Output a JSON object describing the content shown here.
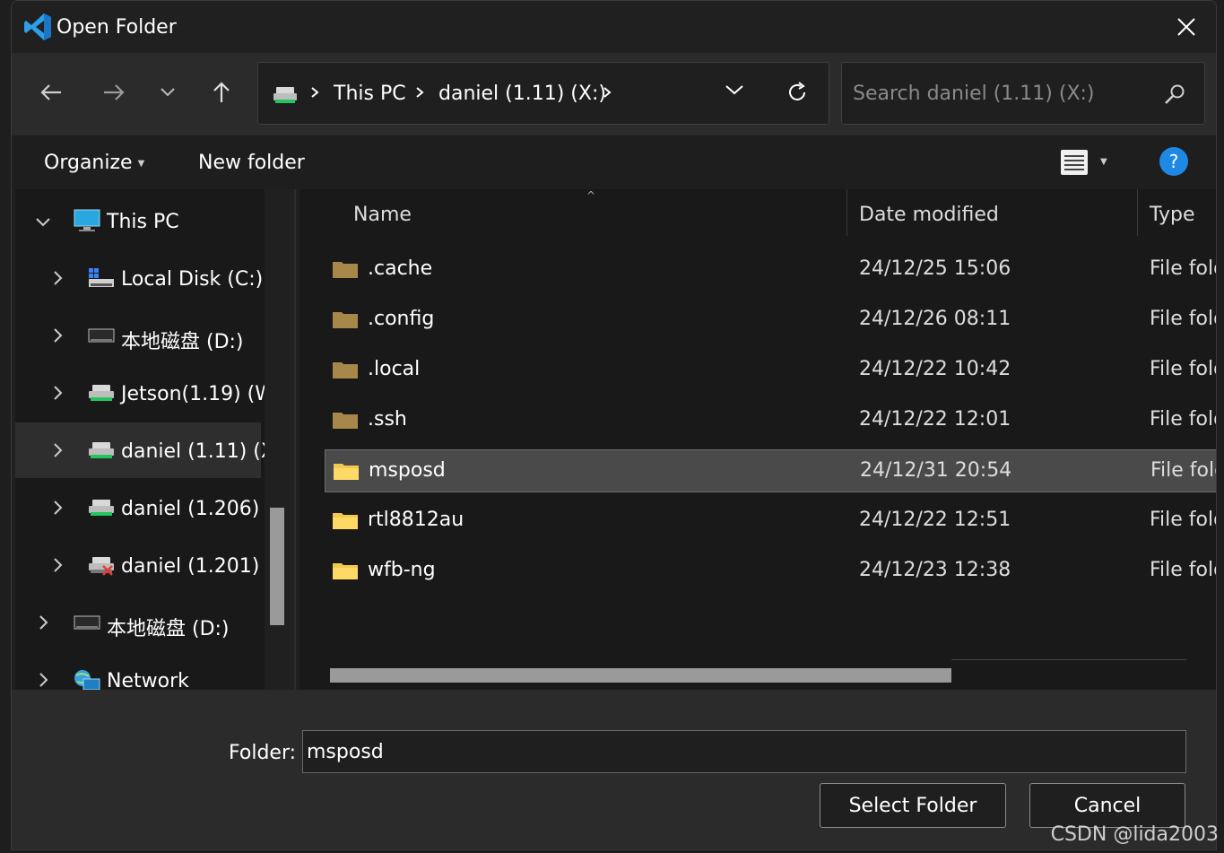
{
  "window": {
    "title": "Open Folder",
    "app_icon": "vscode-icon",
    "close_icon": "close-icon"
  },
  "nav": {
    "back_icon": "arrow-left-icon",
    "forward_icon": "arrow-right-icon",
    "recent_icon": "chevron-down-icon",
    "up_icon": "arrow-up-icon"
  },
  "address": {
    "drive_icon": "network-drive-icon",
    "crumbs": [
      "This PC",
      "daniel (1.11) (X:)"
    ],
    "dropdown_icon": "chevron-down-icon",
    "refresh_icon": "refresh-icon"
  },
  "search": {
    "placeholder": "Search daniel (1.11) (X:)",
    "icon": "search-icon"
  },
  "toolbar": {
    "organize_label": "Organize",
    "new_folder_label": "New folder",
    "view_icon": "details-view-icon",
    "help_label": "?"
  },
  "navpane": {
    "items": [
      {
        "label": "This PC",
        "icon": "this-pc-icon",
        "expanded": true
      },
      {
        "label": "Local Disk (C:)",
        "icon": "local-disk-icon"
      },
      {
        "label": "本地磁盘 (D:)",
        "icon": "local-disk-icon"
      },
      {
        "label": "Jetson(1.19) (W",
        "icon": "network-drive-icon"
      },
      {
        "label": "daniel (1.11) (X",
        "icon": "network-drive-icon",
        "selected": true
      },
      {
        "label": "daniel (1.206) (",
        "icon": "network-drive-icon"
      },
      {
        "label": "daniel (1.201) (",
        "icon": "disconnected-drive-icon"
      },
      {
        "label": "本地磁盘 (D:)",
        "icon": "local-disk-icon"
      },
      {
        "label": "Network",
        "icon": "network-icon"
      }
    ]
  },
  "filelist": {
    "columns": [
      "Name",
      "Date modified",
      "Type"
    ],
    "rows": [
      {
        "name": ".cache",
        "date": "24/12/25 15:06",
        "type": "File fold",
        "hidden": true
      },
      {
        "name": ".config",
        "date": "24/12/26 08:11",
        "type": "File fold",
        "hidden": true
      },
      {
        "name": ".local",
        "date": "24/12/22 10:42",
        "type": "File fold",
        "hidden": true
      },
      {
        "name": ".ssh",
        "date": "24/12/22 12:01",
        "type": "File fold",
        "hidden": true
      },
      {
        "name": "msposd",
        "date": "24/12/31 20:54",
        "type": "File fold",
        "selected": true
      },
      {
        "name": "rtl8812au",
        "date": "24/12/22 12:51",
        "type": "File fold"
      },
      {
        "name": "wfb-ng",
        "date": "24/12/23 12:38",
        "type": "File fold"
      }
    ]
  },
  "footer": {
    "folder_label": "Folder:",
    "folder_value": "msposd",
    "select_label": "Select Folder",
    "cancel_label": "Cancel"
  },
  "watermark": "CSDN @lida2003",
  "colors": {
    "accent": "#1e88e5",
    "folder": "#f2c94c",
    "folder_hidden": "#a8884a",
    "drive_green": "#22c55e"
  }
}
